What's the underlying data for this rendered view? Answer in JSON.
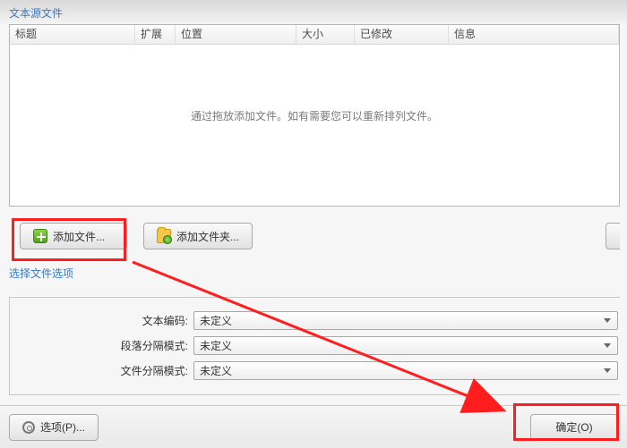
{
  "sections": {
    "source_title": "文本源文件",
    "options_title": "选择文件选项"
  },
  "columns": {
    "title": "标题",
    "ext": "扩展",
    "pos": "位置",
    "size": "大小",
    "mod": "已修改",
    "info": "信息"
  },
  "list": {
    "empty_msg": "通过拖放添加文件。如有需要您可以重新排列文件。"
  },
  "buttons": {
    "add_file": "添加文件...",
    "add_folder": "添加文件夹...",
    "options": "选项(P)...",
    "ok": "确定(O)"
  },
  "options": {
    "encoding_label": "文本编码:",
    "para_mode_label": "段落分隔模式:",
    "file_mode_label": "文件分隔模式:",
    "encoding_value": "未定义",
    "para_mode_value": "未定义",
    "file_mode_value": "未定义"
  }
}
